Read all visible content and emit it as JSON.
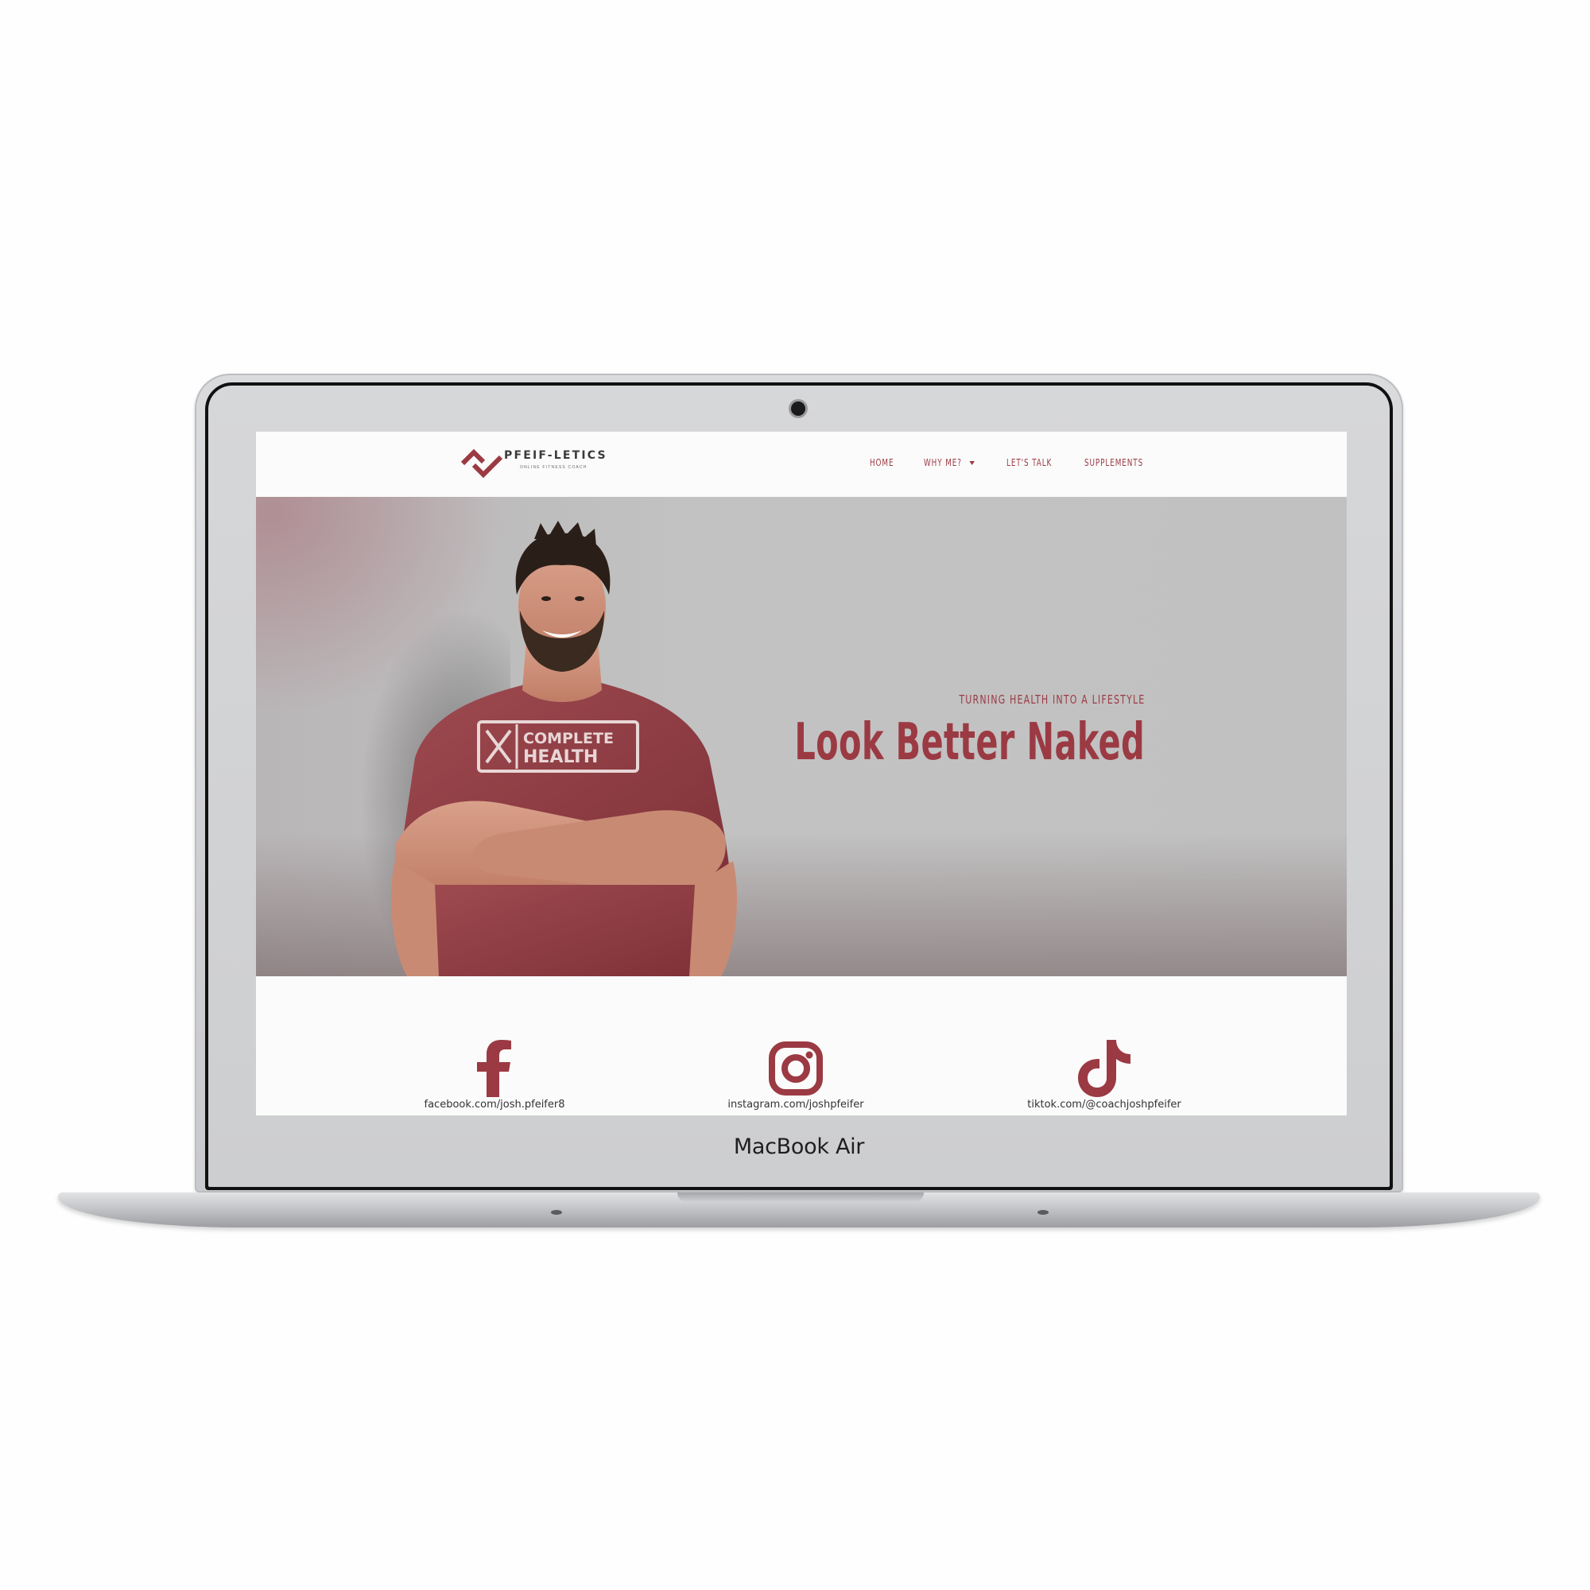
{
  "device": {
    "label": "MacBook Air"
  },
  "brand": {
    "name": "PFEIF-LETICS",
    "tagline": "ONLINE FITNESS COACH",
    "accent_color": "#9b3a43"
  },
  "nav": {
    "items": [
      {
        "label": "HOME"
      },
      {
        "label": "WHY ME?",
        "has_dropdown": true
      },
      {
        "label": "LET'S TALK"
      },
      {
        "label": "SUPPLEMENTS"
      }
    ]
  },
  "hero": {
    "eyebrow": "TURNING HEALTH INTO A LIFESTYLE",
    "title": "Look Better Naked",
    "shirt_text": [
      "COMPLETE",
      "HEALTH"
    ]
  },
  "social": {
    "links": [
      {
        "icon": "facebook-icon",
        "text": "facebook.com/josh.pfeifer8"
      },
      {
        "icon": "instagram-icon",
        "text": "instagram.com/joshpfeifer"
      },
      {
        "icon": "tiktok-icon",
        "text": "tiktok.com/@coachjoshpfeifer"
      }
    ]
  }
}
